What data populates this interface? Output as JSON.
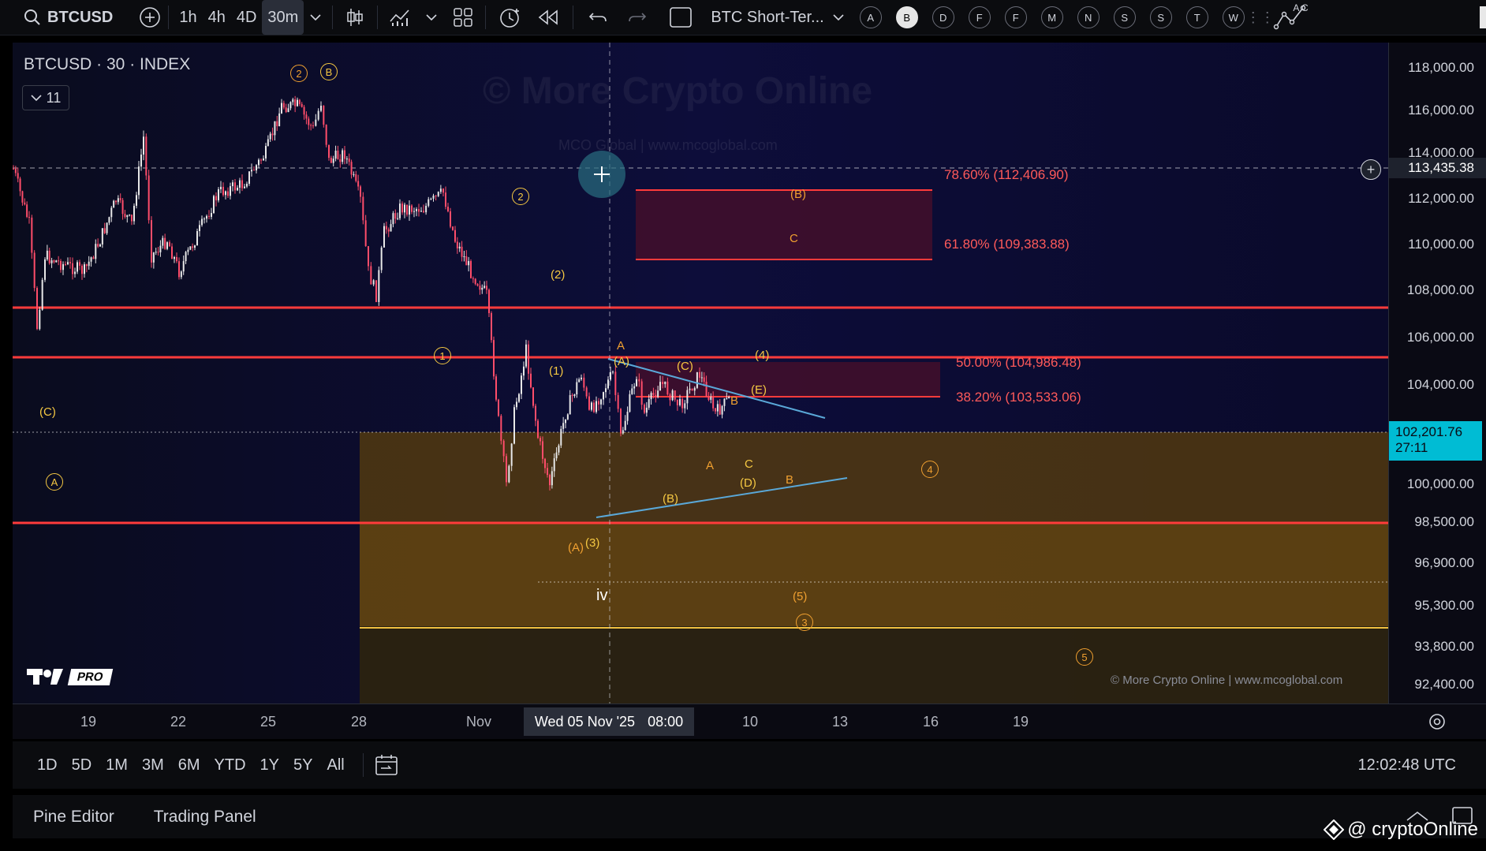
{
  "toolbar": {
    "symbol": "BTCUSD",
    "timeframes": [
      "1h",
      "4h",
      "4D",
      "30m"
    ],
    "active_timeframe": "30m",
    "layout_name": "BTC Short-Ter...",
    "alert_letters": [
      "A",
      "B",
      "D",
      "F",
      "F",
      "M",
      "N",
      "S",
      "S",
      "T",
      "W"
    ],
    "selected_letter": "B",
    "right_letters": "A C"
  },
  "chart": {
    "title": "BTCUSD · 30 · INDEX",
    "indicator_count": "11",
    "watermark": "© More Crypto Online",
    "watermark_sub": "MCO Global  |  www.mcoglobal.com",
    "footer_credit": "© More Crypto Online  |  www.mcoglobal.com",
    "logo_badge": "PRO",
    "cursor_date": "Wed 05 Nov '25",
    "cursor_time": "08:00"
  },
  "colors": {
    "background": "#0c0c28",
    "red_line": "#ff3b3b",
    "fib_text": "#ff5a5a",
    "zone": "#6b4a10",
    "wave_yellow": "#f5c842",
    "wave_orange": "#f0a030",
    "trendline": "#5aa8d8",
    "price_badge": "#00bcd4"
  },
  "fib_levels": [
    {
      "label": "78.60% (112,406.90)",
      "price": 112406.9
    },
    {
      "label": "61.80% (109,383.88)",
      "price": 109383.88
    },
    {
      "label": "50.00% (104,986.48)",
      "price": 104986.48
    },
    {
      "label": "38.20% (103,533.06)",
      "price": 103533.06
    }
  ],
  "price_axis": {
    "labels": [
      "118,000.00",
      "116,000.00",
      "114,000.00",
      "112,000.00",
      "110,000.00",
      "108,000.00",
      "106,000.00",
      "104,000.00",
      "100,000.00",
      "98,500.00",
      "96,900.00",
      "95,300.00",
      "93,800.00",
      "92,400.00"
    ],
    "crosshair_price": "113,435.38",
    "last_price": "102,201.76",
    "countdown": "27:11"
  },
  "time_axis": {
    "labels": [
      "19",
      "22",
      "25",
      "28",
      "Nov",
      "10",
      "13",
      "16",
      "19"
    ]
  },
  "waves": {
    "circled": [
      "2",
      "B",
      "2",
      "1",
      "A",
      "4",
      "3",
      "5"
    ],
    "plain": [
      "(C)",
      "(2)",
      "(1)",
      "A",
      "(A)",
      "(C)",
      "(4)",
      "(E)",
      "B",
      "A",
      "C",
      "(D)",
      "B",
      "(B)",
      "(A)",
      "(3)",
      "iv",
      "(5)",
      "(B)",
      "C"
    ]
  },
  "range_buttons": [
    "1D",
    "5D",
    "1M",
    "3M",
    "6M",
    "YTD",
    "1Y",
    "5Y",
    "All"
  ],
  "clock": "12:02:48 UTC",
  "bottom_tabs": [
    "Pine Editor",
    "Trading Panel"
  ],
  "handle": "@ cryptoOnline"
}
